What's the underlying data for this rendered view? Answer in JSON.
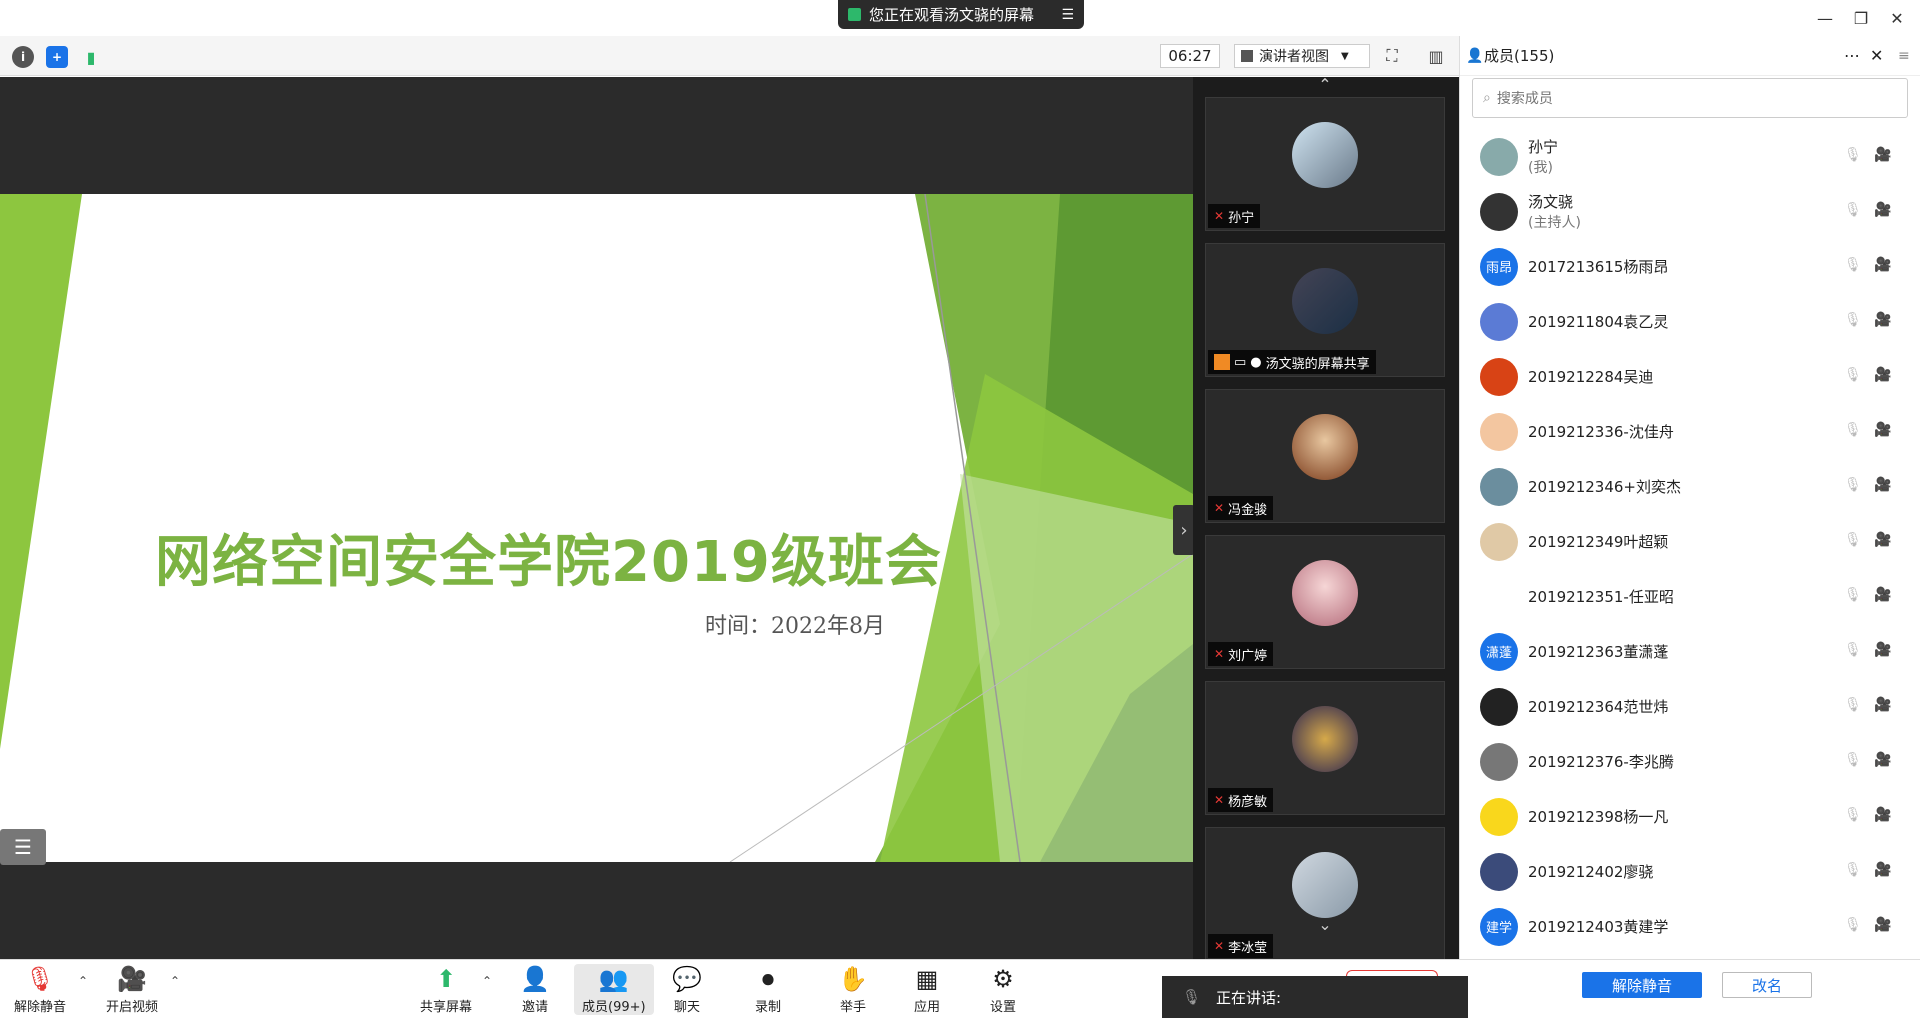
{
  "banner": {
    "text": "您正在观看汤文骁的屏幕"
  },
  "toolbar": {
    "timer": "06:27",
    "view_label": "演讲者视图"
  },
  "slide": {
    "title": "网络空间安全学院2019级班会",
    "subtitle": "时间：2022年8月"
  },
  "videos": [
    {
      "name": "孙宁"
    },
    {
      "name": "汤文骁的屏幕共享"
    },
    {
      "name": "冯金骏"
    },
    {
      "name": "刘广婷"
    },
    {
      "name": "杨彦敏"
    },
    {
      "name": "李冰莹"
    }
  ],
  "panel": {
    "title": "成员(155)",
    "search_placeholder": "搜索成员"
  },
  "members": [
    {
      "name": "孙宁",
      "sub": "(我)",
      "avatar": "",
      "color": "#8aa"
    },
    {
      "name": "汤文骁",
      "sub": "(主持人)",
      "avatar": "",
      "color": "#333"
    },
    {
      "name": "2017213615杨雨昂",
      "sub": "",
      "avatar": "雨昂",
      "color": "#1a73e8"
    },
    {
      "name": "2019211804袁乙灵",
      "sub": "",
      "avatar": "",
      "color": "#5b7bd5"
    },
    {
      "name": "2019212284吴迪",
      "sub": "",
      "avatar": "",
      "color": "#d84315"
    },
    {
      "name": "2019212336-沈佳舟",
      "sub": "",
      "avatar": "",
      "color": "#f3c6a0"
    },
    {
      "name": "2019212346+刘奕杰",
      "sub": "",
      "avatar": "",
      "color": "#6b8e9e"
    },
    {
      "name": "2019212349叶超颖",
      "sub": "",
      "avatar": "",
      "color": "#e0c9a6"
    },
    {
      "name": "2019212351-任亚昭",
      "sub": "",
      "avatar": "",
      "color": "#fff"
    },
    {
      "name": "2019212363董潇蓬",
      "sub": "",
      "avatar": "潇蓬",
      "color": "#1a73e8"
    },
    {
      "name": "2019212364范世炜",
      "sub": "",
      "avatar": "",
      "color": "#222"
    },
    {
      "name": "2019212376-李兆腾",
      "sub": "",
      "avatar": "",
      "color": "#777"
    },
    {
      "name": "2019212398杨一凡",
      "sub": "",
      "avatar": "",
      "color": "#f9d71c"
    },
    {
      "name": "2019212402廖骁",
      "sub": "",
      "avatar": "",
      "color": "#3b4b7a"
    },
    {
      "name": "2019212403黄建学",
      "sub": "",
      "avatar": "建学",
      "color": "#1a73e8"
    }
  ],
  "bottom": {
    "unmute": "解除静音",
    "video": "开启视频",
    "share": "共享屏幕",
    "invite": "邀请",
    "members": "成员(99+)",
    "chat": "聊天",
    "record": "录制",
    "raise_hand": "举手",
    "apps": "应用",
    "settings": "设置",
    "speaking": "正在讲话:",
    "panel_unmute": "解除静音",
    "panel_rename": "改名"
  }
}
